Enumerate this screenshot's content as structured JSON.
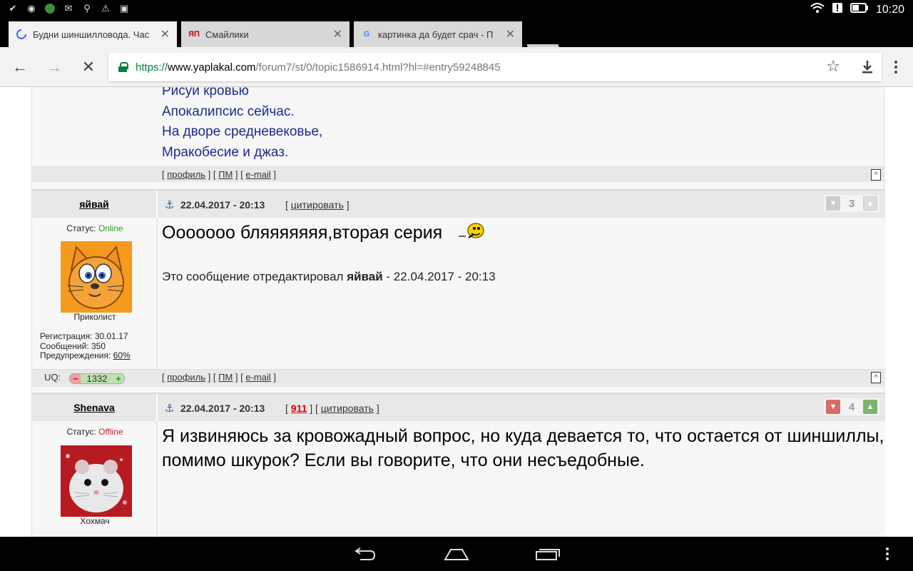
{
  "statusbar": {
    "icons_left": [
      "check-icon",
      "gamepad-icon",
      "app-icon",
      "gmail-icon",
      "search-icon",
      "warning-icon",
      "photo-icon"
    ],
    "time": "10:20"
  },
  "tabs": [
    {
      "title": "Будни шиншилловода. Час",
      "favicon": "loading-spinner-icon"
    },
    {
      "title": "Смайлики",
      "favicon": "ЯП"
    },
    {
      "title": "картинка да будет срач - П",
      "favicon": "G"
    }
  ],
  "address": {
    "scheme": "https://",
    "host": "www.yaplakal.com",
    "path": "/forum7/st/0/topic1586914.html?hl=#entry59248845"
  },
  "prev_post": {
    "lines": [
      "Рисуй кровью",
      "Апокалипсис сейчас.",
      "На дворе средневековье,",
      "Мракобесие и джаз."
    ]
  },
  "footer_links": {
    "open1": "[ ",
    "profile": "профиль",
    "sep1": " ] [ ",
    "pm": "ПМ",
    "sep2": " ] [ ",
    "email": "e-mail",
    "close": " ]",
    "up": "[^]"
  },
  "posts": [
    {
      "author": "яйвай",
      "status_label": "Статус: ",
      "status": "Online",
      "rank": "Приколист",
      "reg": "Регистрация: 30.01.17",
      "msgs": "Сообщений: 350",
      "warn_label": "Предупреждения: ",
      "warn_value": "60%",
      "date": "22.04.2017 - 20:13",
      "quote_open": "[ ",
      "quote": "цитировать",
      "quote_close": " ]",
      "votes": "3",
      "text": "Ооооооо бляяяяяяя,вторая серия",
      "edit_prefix": "Это сообщение отредактировал ",
      "edit_author": "яйвай",
      "edit_date": " - 22.04.2017 - 20:13",
      "uq_label": "UQ:",
      "uq_minus": "−",
      "uq_value": "1332",
      "uq_plus": "+"
    },
    {
      "author": "Shenava",
      "status_label": "Статус: ",
      "status": "Offline",
      "rank": "Хохмач",
      "date": "22.04.2017 - 20:13",
      "quote_open": "[ ",
      "num": "911",
      "quote_mid": " ] [ ",
      "quote": "цитировать",
      "quote_close": " ]",
      "votes": "4",
      "text": "Я извиняюсь за кровожадный вопрос, но куда девается то, что остается от шиншиллы, помимо шкурок? Если вы говорите, что они несъедобные."
    }
  ],
  "colors": {
    "link_text": "#1d2a8f",
    "online": "#2a9d2a",
    "offline": "#c0262f",
    "secure": "#0b8043"
  }
}
